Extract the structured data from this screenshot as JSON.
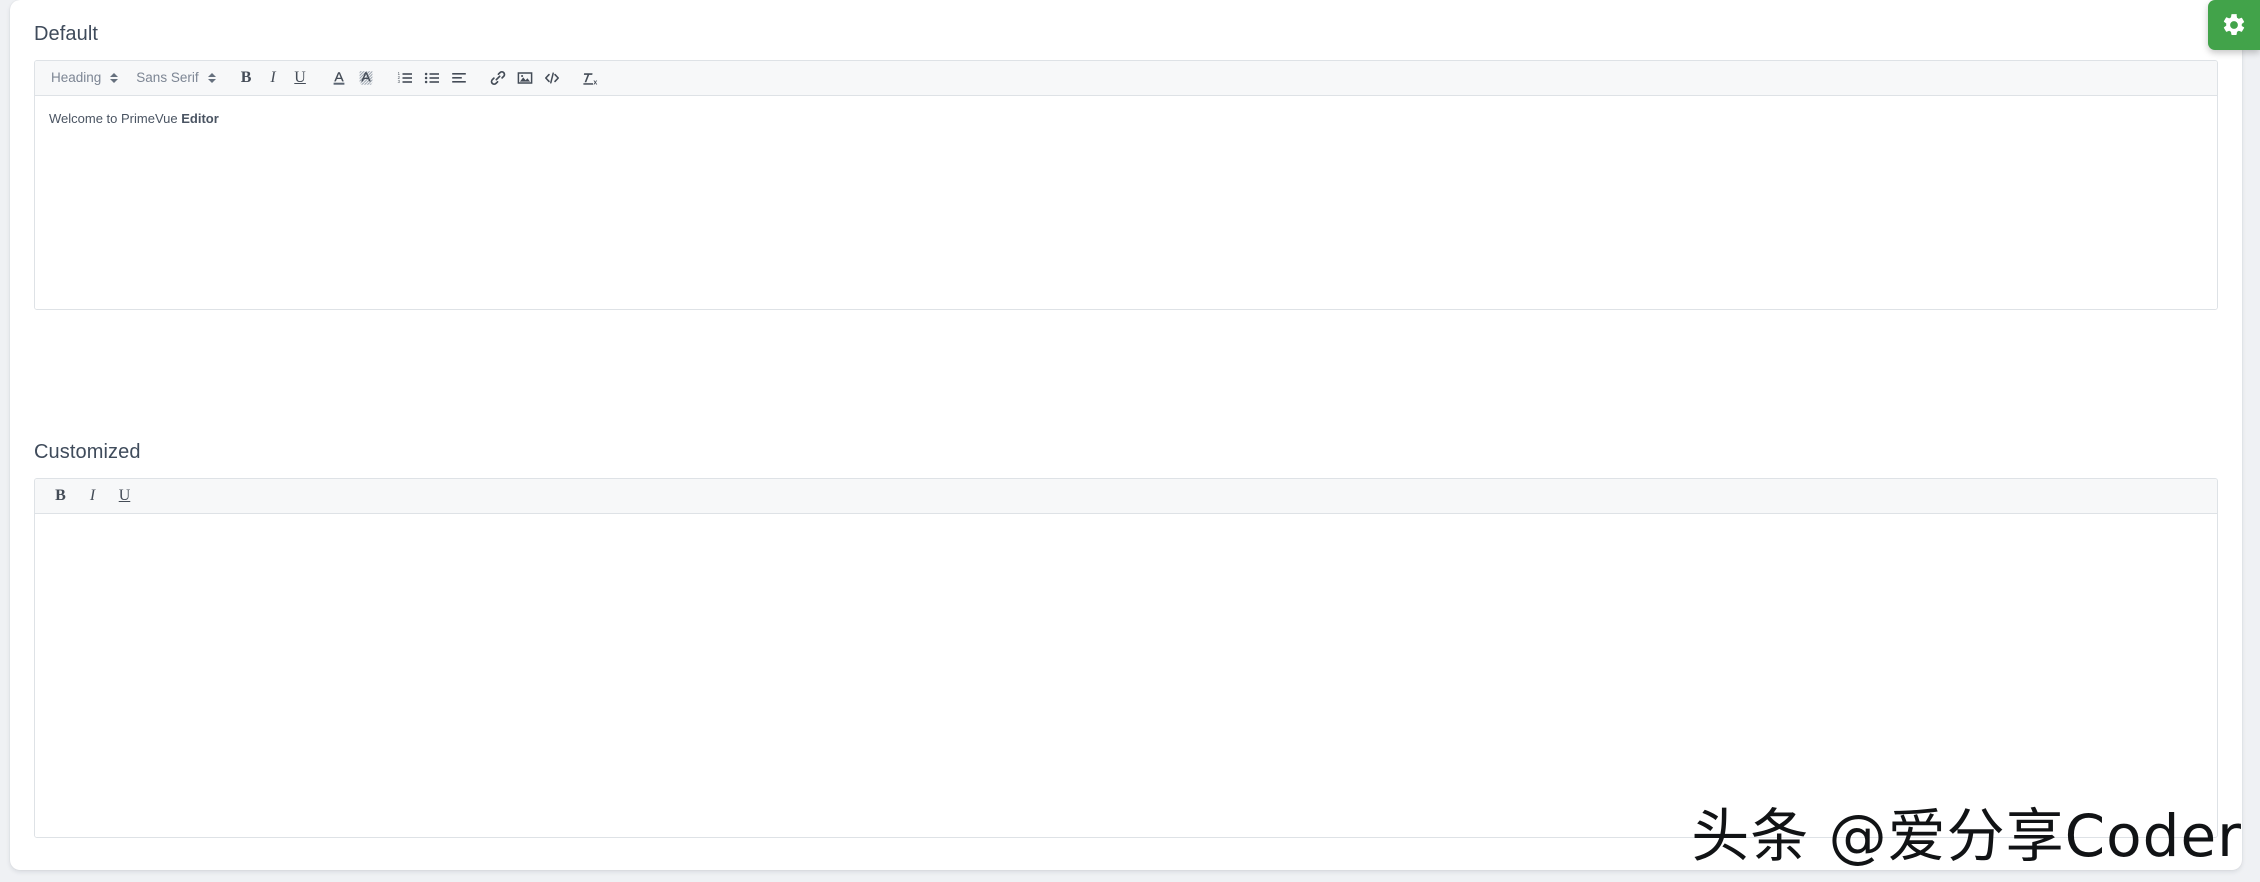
{
  "page": {
    "background_color": "#eff1f4",
    "card_color": "#ffffff"
  },
  "fab": {
    "name": "settings-gear",
    "icon": "gear-icon",
    "color": "#42a34a",
    "label": ""
  },
  "sections": [
    {
      "id": "default",
      "title": "Default",
      "editor": {
        "content_html": "Welcome to PrimeVue <b>Editor</b>",
        "content_plain": "Welcome to PrimeVue Editor",
        "content_prefix": "Welcome to PrimeVue ",
        "content_bold": "Editor",
        "toolbar": {
          "pickers": [
            {
              "name": "header-picker",
              "value": "Heading"
            },
            {
              "name": "font-picker",
              "value": "Sans Serif"
            }
          ],
          "buttons": [
            {
              "name": "bold-button",
              "icon": "bold-icon",
              "label": "B"
            },
            {
              "name": "italic-button",
              "icon": "italic-icon",
              "label": "I"
            },
            {
              "name": "underline-button",
              "icon": "underline-icon",
              "label": "U"
            },
            {
              "name": "text-color-button",
              "icon": "text-color-icon",
              "label": "A"
            },
            {
              "name": "background-color-button",
              "icon": "background-color-icon",
              "label": "A"
            },
            {
              "name": "ordered-list-button",
              "icon": "ordered-list-icon",
              "label": ""
            },
            {
              "name": "bullet-list-button",
              "icon": "bullet-list-icon",
              "label": ""
            },
            {
              "name": "align-button",
              "icon": "align-left-icon",
              "label": ""
            },
            {
              "name": "link-button",
              "icon": "link-icon",
              "label": ""
            },
            {
              "name": "image-button",
              "icon": "image-icon",
              "label": ""
            },
            {
              "name": "code-block-button",
              "icon": "code-icon",
              "label": ""
            },
            {
              "name": "clear-format-button",
              "icon": "clear-format-icon",
              "label": ""
            }
          ]
        }
      }
    },
    {
      "id": "customized",
      "title": "Customized",
      "editor": {
        "content_html": "",
        "content_plain": "",
        "toolbar": {
          "pickers": [],
          "buttons": [
            {
              "name": "bold-button",
              "icon": "bold-icon",
              "label": "B"
            },
            {
              "name": "italic-button",
              "icon": "italic-icon",
              "label": "I"
            },
            {
              "name": "underline-button",
              "icon": "underline-icon",
              "label": "U"
            }
          ]
        }
      }
    }
  ],
  "watermark": {
    "text": "头条 @爱分享Coder"
  }
}
